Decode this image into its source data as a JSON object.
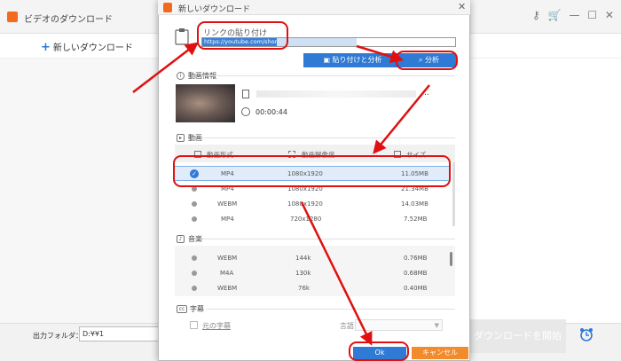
{
  "main_window": {
    "title": "ビデオのダウンロード",
    "new_download": "新しいダウンロード",
    "output_folder_label": "出力フォルダ：",
    "output_folder_value": "D:¥¥1",
    "download_all_button": "ダウンロードを開始",
    "window_controls": [
      "minimize",
      "maximize",
      "close"
    ],
    "toolbar_icons": [
      "key-icon",
      "cart-icon"
    ]
  },
  "dialog": {
    "title": "新しいダウンロード",
    "link_label": "リンクの貼り付け",
    "url_value": "https://youtube.com/shorts/",
    "paste_analyze_button": "貼り付けと分析",
    "analyze_button": "分析",
    "sections": {
      "info": "動画情報",
      "video": "動画",
      "audio": "音楽",
      "subtitle": "字幕"
    },
    "video_info": {
      "title": "..",
      "duration": "00:00:44"
    },
    "video_columns": [
      "動画形式",
      "動画解像度",
      "サイズ"
    ],
    "video_rows": [
      {
        "format": "MP4",
        "resolution": "1080x1920",
        "size": "11.05MB",
        "selected": true
      },
      {
        "format": "MP4",
        "resolution": "1080x1920",
        "size": "21.34MB",
        "selected": false
      },
      {
        "format": "WEBM",
        "resolution": "1080x1920",
        "size": "14.03MB",
        "selected": false
      },
      {
        "format": "MP4",
        "resolution": "720x1280",
        "size": "7.52MB",
        "selected": false
      }
    ],
    "audio_rows": [
      {
        "format": "WEBM",
        "bitrate": "144k",
        "size": "0.76MB"
      },
      {
        "format": "M4A",
        "bitrate": "130k",
        "size": "0.68MB"
      },
      {
        "format": "WEBM",
        "bitrate": "76k",
        "size": "0.40MB"
      }
    ],
    "subtitle": {
      "original_label": "元の字幕",
      "language_label": "言語"
    },
    "ok_button": "Ok",
    "cancel_button": "キャンセル"
  },
  "colors": {
    "accent_blue": "#2e7ad4",
    "cancel_orange": "#f28b2c",
    "annotation_red": "#e01010"
  }
}
